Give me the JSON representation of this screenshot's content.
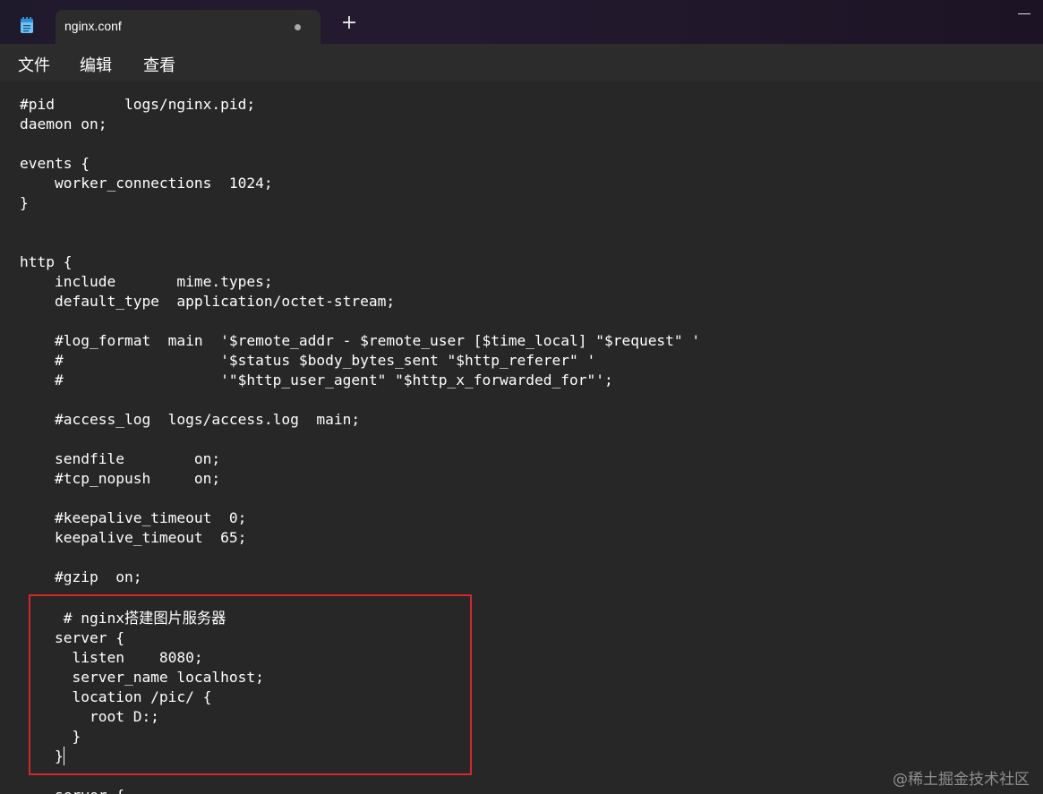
{
  "tab": {
    "title": "nginx.conf",
    "new_tab_label": "+"
  },
  "menu": {
    "items": [
      "文件",
      "编辑",
      "查看"
    ]
  },
  "editor": {
    "lines": [
      "#pid        logs/nginx.pid;",
      "daemon on;",
      "",
      "events {",
      "    worker_connections  1024;",
      "}",
      "",
      "",
      "http {",
      "    include       mime.types;",
      "    default_type  application/octet-stream;",
      "",
      "    #log_format  main  '$remote_addr - $remote_user [$time_local] \"$request\" '",
      "    #                  '$status $body_bytes_sent \"$http_referer\" '",
      "    #                  '\"$http_user_agent\" \"$http_x_forwarded_for\"';",
      "",
      "    #access_log  logs/access.log  main;",
      "",
      "    sendfile        on;",
      "    #tcp_nopush     on;",
      "",
      "    #keepalive_timeout  0;",
      "    keepalive_timeout  65;",
      "",
      "    #gzip  on;",
      "",
      "     # nginx搭建图片服务器",
      "    server {",
      "      listen    8080;",
      "      server_name localhost;",
      "      location /pic/ {",
      "        root D:;",
      "      }",
      "    }",
      "",
      "    server {"
    ]
  },
  "watermark": "@稀土掘金技术社区",
  "colors": {
    "highlight_border": "#d42828",
    "editor_bg": "#272727",
    "text": "#ffffff"
  }
}
